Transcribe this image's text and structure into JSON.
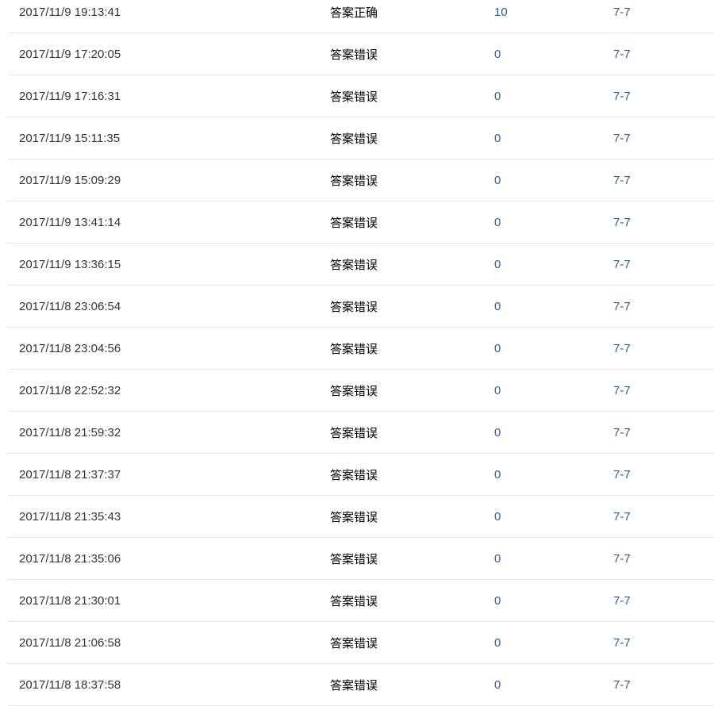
{
  "colors": {
    "result_correct": "#d9473a",
    "result_wrong": "#4fa05a",
    "link": "#2f5d91",
    "text": "#333333",
    "divider": "#e6e6e6"
  },
  "rows": [
    {
      "time": "2017/11/9 19:13:41",
      "result": "答案正确",
      "status": "correct",
      "score": "10",
      "problem": "7-7"
    },
    {
      "time": "2017/11/9 17:20:05",
      "result": "答案错误",
      "status": "wrong",
      "score": "0",
      "problem": "7-7"
    },
    {
      "time": "2017/11/9 17:16:31",
      "result": "答案错误",
      "status": "wrong",
      "score": "0",
      "problem": "7-7"
    },
    {
      "time": "2017/11/9 15:11:35",
      "result": "答案错误",
      "status": "wrong",
      "score": "0",
      "problem": "7-7"
    },
    {
      "time": "2017/11/9 15:09:29",
      "result": "答案错误",
      "status": "wrong",
      "score": "0",
      "problem": "7-7"
    },
    {
      "time": "2017/11/9 13:41:14",
      "result": "答案错误",
      "status": "wrong",
      "score": "0",
      "problem": "7-7"
    },
    {
      "time": "2017/11/9 13:36:15",
      "result": "答案错误",
      "status": "wrong",
      "score": "0",
      "problem": "7-7"
    },
    {
      "time": "2017/11/8 23:06:54",
      "result": "答案错误",
      "status": "wrong",
      "score": "0",
      "problem": "7-7"
    },
    {
      "time": "2017/11/8 23:04:56",
      "result": "答案错误",
      "status": "wrong",
      "score": "0",
      "problem": "7-7"
    },
    {
      "time": "2017/11/8 22:52:32",
      "result": "答案错误",
      "status": "wrong",
      "score": "0",
      "problem": "7-7"
    },
    {
      "time": "2017/11/8 21:59:32",
      "result": "答案错误",
      "status": "wrong",
      "score": "0",
      "problem": "7-7"
    },
    {
      "time": "2017/11/8 21:37:37",
      "result": "答案错误",
      "status": "wrong",
      "score": "0",
      "problem": "7-7"
    },
    {
      "time": "2017/11/8 21:35:43",
      "result": "答案错误",
      "status": "wrong",
      "score": "0",
      "problem": "7-7"
    },
    {
      "time": "2017/11/8 21:35:06",
      "result": "答案错误",
      "status": "wrong",
      "score": "0",
      "problem": "7-7"
    },
    {
      "time": "2017/11/8 21:30:01",
      "result": "答案错误",
      "status": "wrong",
      "score": "0",
      "problem": "7-7"
    },
    {
      "time": "2017/11/8 21:06:58",
      "result": "答案错误",
      "status": "wrong",
      "score": "0",
      "problem": "7-7"
    },
    {
      "time": "2017/11/8 18:37:58",
      "result": "答案错误",
      "status": "wrong",
      "score": "0",
      "problem": "7-7"
    }
  ]
}
